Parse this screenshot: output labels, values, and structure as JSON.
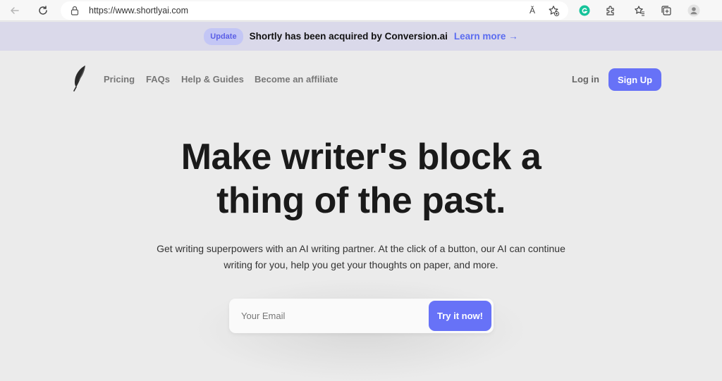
{
  "browser": {
    "url": "https://www.shortlyai.com",
    "read_aloud_label": "Ă",
    "icons": [
      "back-icon",
      "refresh-icon",
      "lock-icon",
      "read-aloud-icon",
      "favorite-add-icon",
      "grammarly-icon",
      "extensions-icon",
      "favorites-icon",
      "collections-icon",
      "profile-icon"
    ]
  },
  "banner": {
    "badge": "Update",
    "text": "Shortly has been acquired by Conversion.ai",
    "link": "Learn more →"
  },
  "header": {
    "nav": [
      "Pricing",
      "FAQs",
      "Help & Guides",
      "Become an affiliate"
    ],
    "login": "Log in",
    "signup": "Sign Up"
  },
  "hero": {
    "title_line1": "Make writer's block a",
    "title_line2": "thing of the past.",
    "subtitle_line1": "Get writing superpowers with an AI writing partner. At the click of a button, our AI can continue",
    "subtitle_line2": "writing for you, help you get your thoughts on paper, and more."
  },
  "form": {
    "email_placeholder": "Your Email",
    "cta": "Try it now!"
  },
  "colors": {
    "accent": "#6772f7",
    "banner_bg": "#dad9ea",
    "page_bg": "#ebebeb",
    "grammarly": "#15c39a"
  }
}
